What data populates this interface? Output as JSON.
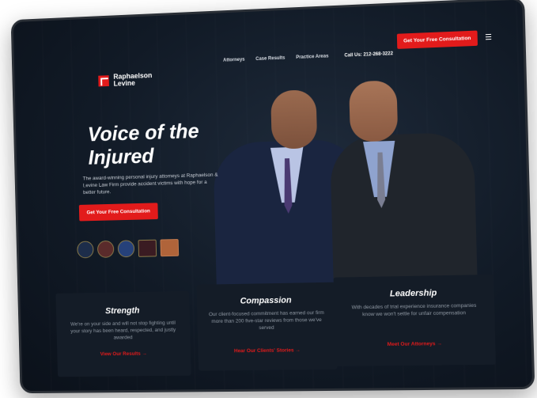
{
  "brand": {
    "name": "Raphaelson Levine"
  },
  "nav": {
    "items": [
      "Attorneys",
      "Case Results",
      "Practice Areas"
    ],
    "phone": "Call Us: 212-268-3222",
    "cta": "Get Your Free Consultation",
    "menu_icon": "hamburger-icon"
  },
  "hero": {
    "title": "Voice of the Injured",
    "subtitle": "The award-winning personal injury attorneys at Raphaelson & Levine Law Firm provide accident victims with hope for a better future.",
    "cta": "Get Your Free Consultation",
    "badges": [
      "badge-1",
      "badge-2",
      "badge-3",
      "badge-4",
      "badge-5"
    ]
  },
  "cards": [
    {
      "title": "Strength",
      "text": "We're on your side and will not stop fighting until your story has been heard, respected, and justly awarded",
      "link": "View Our Results →"
    },
    {
      "title": "Compassion",
      "text": "Our client-focused commitment has earned our firm more than 200 five-star reviews from those we've served",
      "link": "Hear Our Clients' Stories →"
    },
    {
      "title": "Leadership",
      "text": "With decades of trial experience insurance companies know we won't settle for unfair compensation",
      "link": "Meet Our Attorneys →"
    }
  ],
  "colors": {
    "accent": "#e21b1b",
    "background": "#111a26"
  }
}
